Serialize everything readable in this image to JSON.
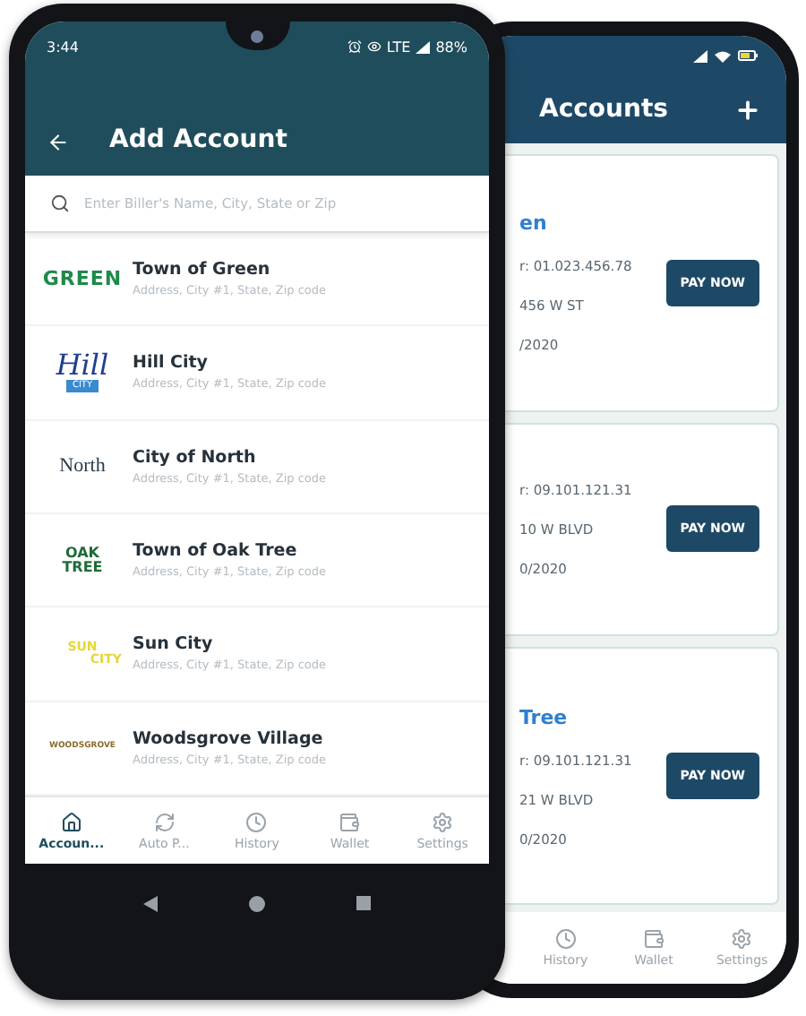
{
  "front_phone": {
    "status_bar": {
      "time": "3:44",
      "network": "LTE",
      "battery": "88%"
    },
    "header": {
      "title": "Add Account"
    },
    "search": {
      "placeholder": "Enter Biller's Name, City, State or Zip"
    },
    "billers": [
      {
        "kind": "green",
        "logo": [
          "GREEN"
        ],
        "name": "Town of Green",
        "address": "Address, City #1, State, Zip code"
      },
      {
        "kind": "hill",
        "logo": [
          "Hill",
          "CITY"
        ],
        "name": "Hill City",
        "address": "Address, City #1, State, Zip code"
      },
      {
        "kind": "north",
        "logo": [
          "North"
        ],
        "name": "City of North",
        "address": "Address, City #1, State, Zip code"
      },
      {
        "kind": "oak",
        "logo": [
          "OAK",
          "TREE"
        ],
        "name": "Town of Oak Tree",
        "address": "Address, City #1, State, Zip code"
      },
      {
        "kind": "sun",
        "logo": [
          "SUN",
          "CITY"
        ],
        "name": "Sun City",
        "address": "Address, City #1, State, Zip code"
      },
      {
        "kind": "woods",
        "logo": [
          "WOODSGROVE"
        ],
        "name": "Woodsgrove Village",
        "address": "Address, City #1, State, Zip code"
      }
    ],
    "nav": [
      {
        "label": "Accoun...",
        "selected": true
      },
      {
        "label": "Auto P...",
        "selected": false
      },
      {
        "label": "History",
        "selected": false
      },
      {
        "label": "Wallet",
        "selected": false
      },
      {
        "label": "Settings",
        "selected": false
      }
    ]
  },
  "back_phone": {
    "header": {
      "title": "Accounts"
    },
    "accounts": [
      {
        "name": "en",
        "number": "r:  01.023.456.78",
        "address": "456 W ST",
        "date": "/2020",
        "button": "PAY NOW"
      },
      {
        "number": "r:  09.101.121.31",
        "address": "10 W BLVD",
        "date": "0/2020",
        "button": "PAY NOW"
      },
      {
        "name": "Tree",
        "number": "r:  09.101.121.31",
        "address": "21 W BLVD",
        "date": "0/2020",
        "button": "PAY NOW"
      }
    ],
    "nav": [
      {
        "label": "History",
        "selected": false
      },
      {
        "label": "Wallet",
        "selected": false
      },
      {
        "label": "Settings",
        "selected": false
      }
    ]
  }
}
